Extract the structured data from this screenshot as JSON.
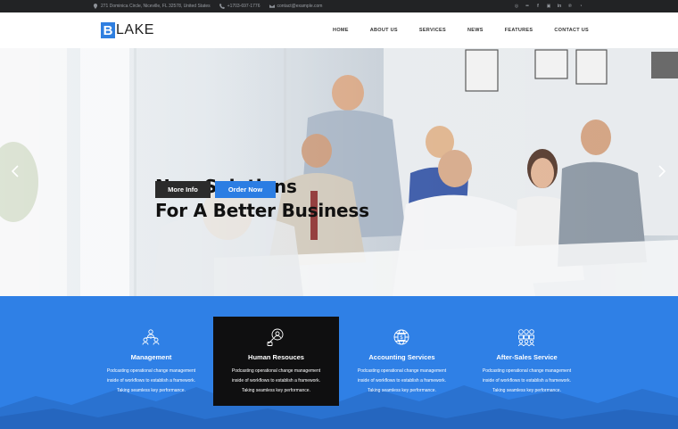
{
  "topbar": {
    "address": "271 Dominica Circle, Niceville, FL 32578, United States",
    "phone": "+1703-697-1776",
    "email": "contact@example.com",
    "social_icons": [
      "dribbble-icon",
      "flickr-icon",
      "facebook-icon",
      "foursquare-icon",
      "linkedin-icon",
      "pinterest-icon",
      "rss-icon"
    ]
  },
  "logo": {
    "letter": "B",
    "text": "LAKE",
    "color": "#2f7fe0"
  },
  "nav": [
    "HOME",
    "ABOUT US",
    "SERVICES",
    "NEWS",
    "FEATURES",
    "CONTACT US"
  ],
  "hero": {
    "title_line1": "New Solutions",
    "title_line2": "For A Better Business",
    "more_button": "More Info",
    "order_button": "Order Now"
  },
  "services": {
    "accent": "#2f80e6",
    "items": [
      {
        "title": "Management",
        "icon": "team-hierarchy-icon",
        "line1": "Podcasting operational change management",
        "line2": "inside of workflows to establish a framework.",
        "line3": "Taking seamless key performance."
      },
      {
        "title": "Human Resouces",
        "icon": "person-search-icon",
        "line1": "Podcasting operational change management",
        "line2": "inside of workflows to establish a framework.",
        "line3": "Taking seamless key performance."
      },
      {
        "title": "Accounting Services",
        "icon": "accounting-globe-icon",
        "line1": "Podcasting operational change management",
        "line2": "inside of workflows to establish a framework.",
        "line3": "Taking seamless key performance."
      },
      {
        "title": "After-Sales Service",
        "icon": "customer-service-icon",
        "line1": "Podcasting operational change management",
        "line2": "inside of workflows to establish a framework.",
        "line3": "Taking seamless key performance."
      }
    ]
  }
}
